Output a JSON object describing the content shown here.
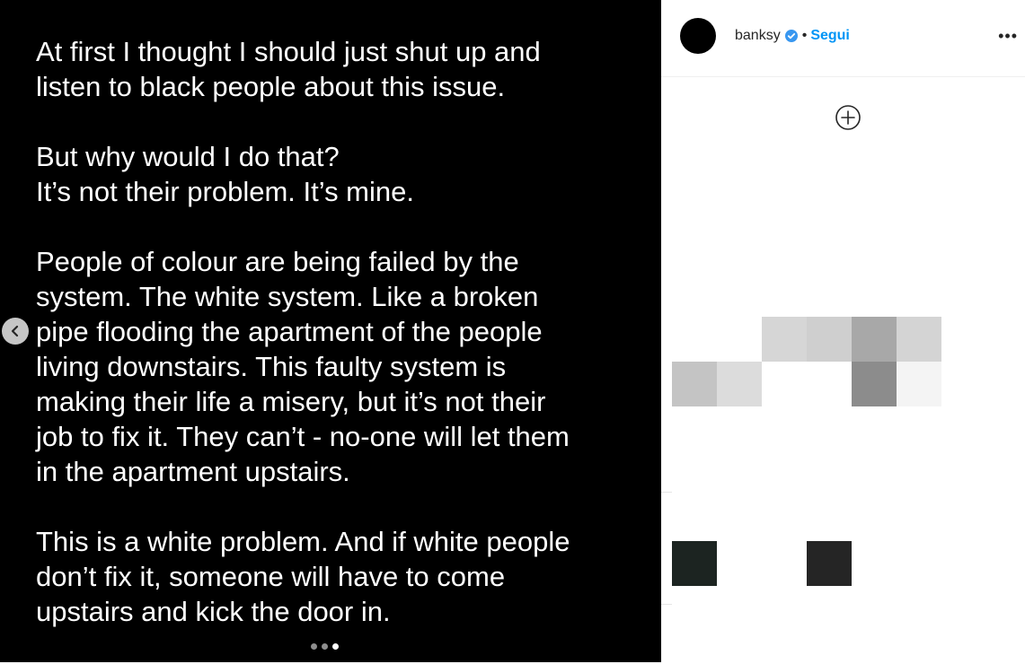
{
  "post": {
    "paragraphs": [
      "At first I thought I should just shut up and\nlisten to black people about this issue.",
      "But why would I do that?\nIt’s not their problem. It’s mine.",
      "People of colour are being failed by the\nsystem. The white system. Like a broken\npipe flooding the apartment of the people\nliving downstairs. This faulty system is\nmaking their life a misery, but it’s not their\njob to fix it. They can’t - no-one will let them\nin the apartment upstairs.",
      "This is a white problem. And if white people\ndon’t fix it, someone will have to come\nupstairs and kick the door in."
    ],
    "carousel": {
      "total": 3,
      "active_index": 2
    }
  },
  "header": {
    "username": "banksy",
    "separator": "•",
    "follow_label": "Segui",
    "more_label": "•••"
  },
  "icons": {
    "prev": "chevron-left-icon",
    "verified": "verified-badge-icon",
    "add": "add-circle-icon",
    "more": "more-options-icon"
  },
  "colors": {
    "image_background": "#000000",
    "post_text": "#ffffff",
    "link_blue": "#0095f6",
    "verified_blue": "#3897f0"
  }
}
